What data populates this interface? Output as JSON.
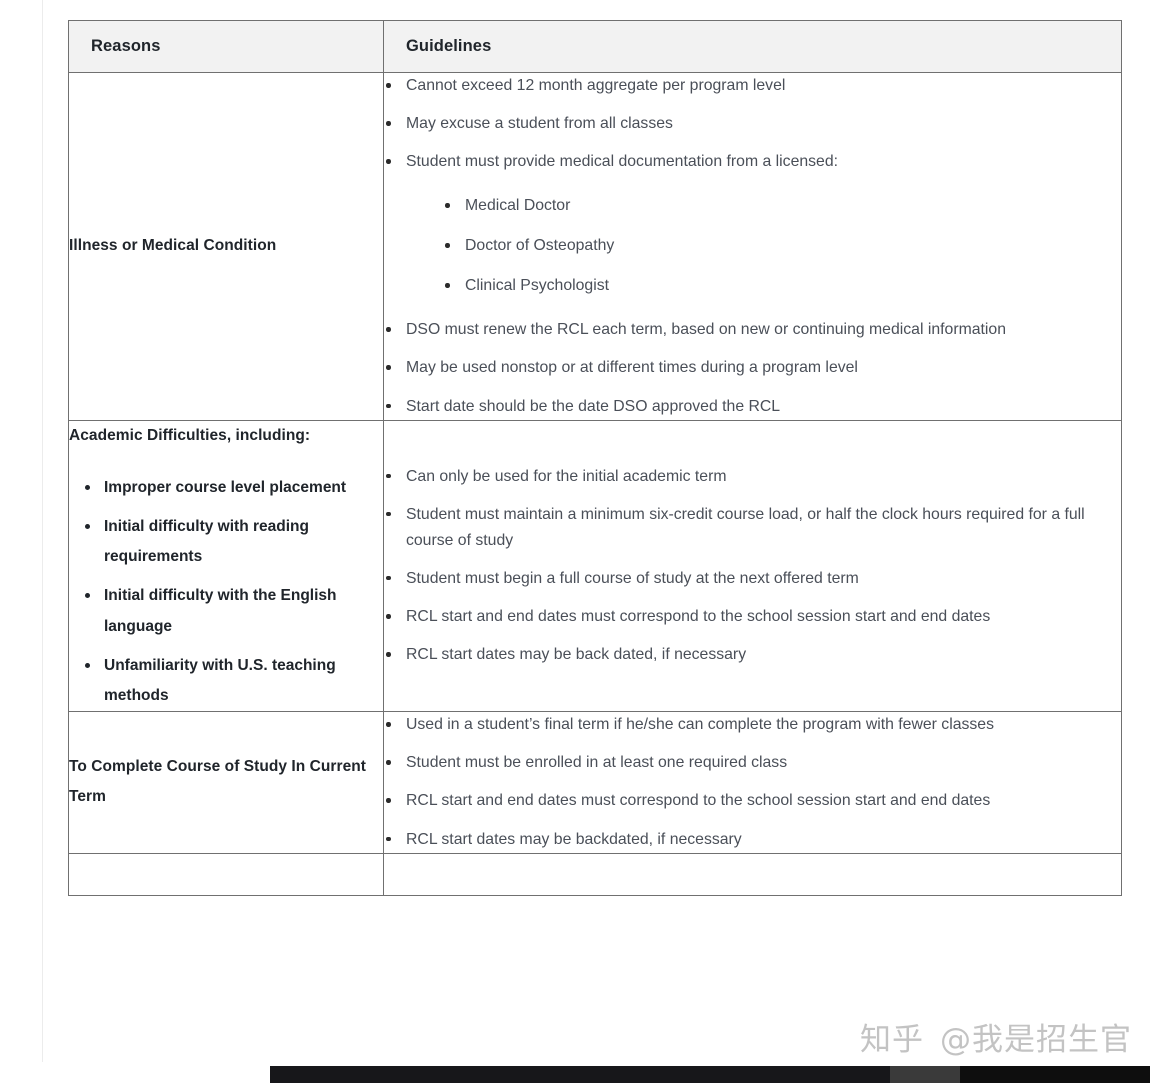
{
  "table": {
    "columns": [
      {
        "key": "reasons",
        "label": "Reasons"
      },
      {
        "key": "guidelines",
        "label": "Guidelines"
      }
    ],
    "rows": [
      {
        "reason": {
          "title": "Illness or Medical Condition",
          "sub_items": []
        },
        "guidelines": [
          {
            "text": "Cannot exceed 12 month aggregate per program level"
          },
          {
            "text": "May excuse a student from all classes"
          },
          {
            "text": "Student must provide medical documentation from a licensed:",
            "children": [
              "Medical Doctor",
              "Doctor of Osteopathy",
              "Clinical Psychologist"
            ]
          },
          {
            "text": "DSO must renew the RCL each term, based on new or continuing medical information"
          },
          {
            "text": "May be used nonstop or at different times during a program level"
          },
          {
            "text": "Start date should be the date DSO approved the RCL"
          }
        ]
      },
      {
        "reason": {
          "title": "Academic Difficulties, including:",
          "sub_items": [
            "Improper course level placement",
            "Initial difficulty with reading requirements",
            "Initial difficulty with the English language",
            "Unfamiliarity with U.S. teaching methods"
          ]
        },
        "guidelines": [
          {
            "text": "Can only be used for the initial academic term"
          },
          {
            "text": "Student must maintain a minimum six-credit course load, or half the clock hours required for a full course of study"
          },
          {
            "text": "Student must begin a full course of study at the next offered term"
          },
          {
            "text": "RCL start and end dates must correspond to the school session start and end dates"
          },
          {
            "text": "RCL start dates may be back dated, if necessary"
          }
        ]
      },
      {
        "reason": {
          "title": "To Complete Course of Study In Current Term",
          "sub_items": []
        },
        "guidelines": [
          {
            "text": "Used in a student’s final term if he/she can complete the program with fewer classes"
          },
          {
            "text": "Student must be enrolled in at least one required class"
          },
          {
            "text": "RCL start and end dates must correspond to the school session start and end dates"
          },
          {
            "text": "RCL start dates may be backdated, if necessary"
          }
        ]
      },
      {
        "reason": {
          "title": "",
          "sub_items": []
        },
        "guidelines": []
      }
    ]
  },
  "watermark": {
    "logo": "知乎",
    "handle": "@我是招生官"
  },
  "colors": {
    "header_background": "#f2f2f2",
    "border": "#707070",
    "heading_text": "#20252b",
    "body_text": "#4a4f58",
    "bullet": "#2b2b2b",
    "watermark": "#b9b9b9",
    "page_background": "#ffffff",
    "scrollbar": "#0e0e0e"
  }
}
